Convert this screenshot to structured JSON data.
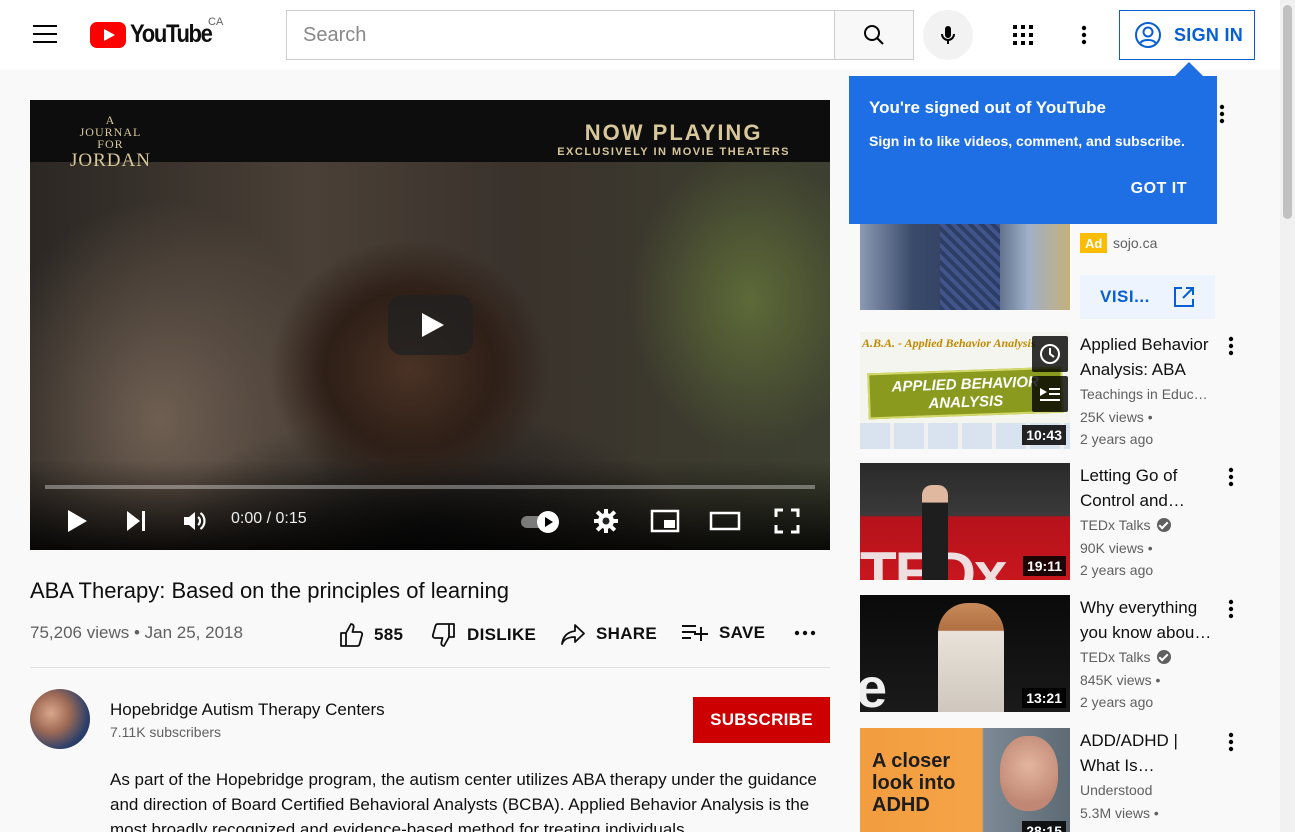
{
  "header": {
    "logo_text": "YouTube",
    "country": "CA",
    "search_placeholder": "Search",
    "signin_label": "SIGN IN"
  },
  "player": {
    "film_title_line1": "A",
    "film_title_line2": "JOURNAL",
    "film_title_line3": "FOR",
    "film_title_line4": "JORDAN",
    "now_playing": "NOW PLAYING",
    "now_playing_sub": "EXCLUSIVELY IN MOVIE THEATERS",
    "time": "0:00 / 0:15",
    "progress_fraction": 0.0
  },
  "video": {
    "title": "ABA Therapy: Based on the principles of learning",
    "meta": "75,206 views • Jan 25, 2018",
    "likes": "585",
    "dislike_label": "DISLIKE",
    "share_label": "SHARE",
    "save_label": "SAVE"
  },
  "channel": {
    "name": "Hopebridge Autism Therapy Centers",
    "subscribers": "7.11K subscribers",
    "subscribe_label": "SUBSCRIBE",
    "description": "As part of the Hopebridge program, the autism center utilizes ABA therapy under the guidance and direction of Board Certified Behavioral Analysts (BCBA). Applied Behavior Analysis is the most broadly recognized and evidence-based method for treating individuals"
  },
  "tooltip": {
    "title": "You're signed out of YouTube",
    "body": "Sign in to like videos, comment, and subscribe.",
    "got_it": "GOT IT"
  },
  "ad": {
    "badge": "Ad",
    "domain": "sojo.ca",
    "visit_label": "VISI..."
  },
  "recommendations": [
    {
      "title": "Applied Behavior Analysis: ABA",
      "channel": "Teachings in Educ…",
      "verified": false,
      "views": "25K views •",
      "age": "2 years ago",
      "duration": "10:43",
      "thumb_text_top": "A.B.A. - Applied Behavior Analysis",
      "thumb_text_band": "APPLIED BEHAVIOR ANALYSIS"
    },
    {
      "title": "Letting Go of Control and…",
      "channel": "TEDx Talks",
      "verified": true,
      "views": "90K views •",
      "age": "2 years ago",
      "duration": "19:11",
      "thumb_text": "TEDx"
    },
    {
      "title": "Why everything you know abou…",
      "channel": "TEDx Talks",
      "verified": true,
      "views": "845K views •",
      "age": "2 years ago",
      "duration": "13:21",
      "thumb_text": "e"
    },
    {
      "title": "ADD/ADHD | What Is…",
      "channel": "Understood",
      "verified": false,
      "views": "5.3M views •",
      "age": "",
      "duration": "28:15",
      "thumb_text": "A closer look into ADHD"
    }
  ],
  "colors": {
    "brand_red": "#ff0000",
    "subscribe_red": "#cc0000",
    "link_blue": "#065fd4",
    "tooltip_blue": "#1e6fe3",
    "ad_yellow": "#fbbc04"
  }
}
